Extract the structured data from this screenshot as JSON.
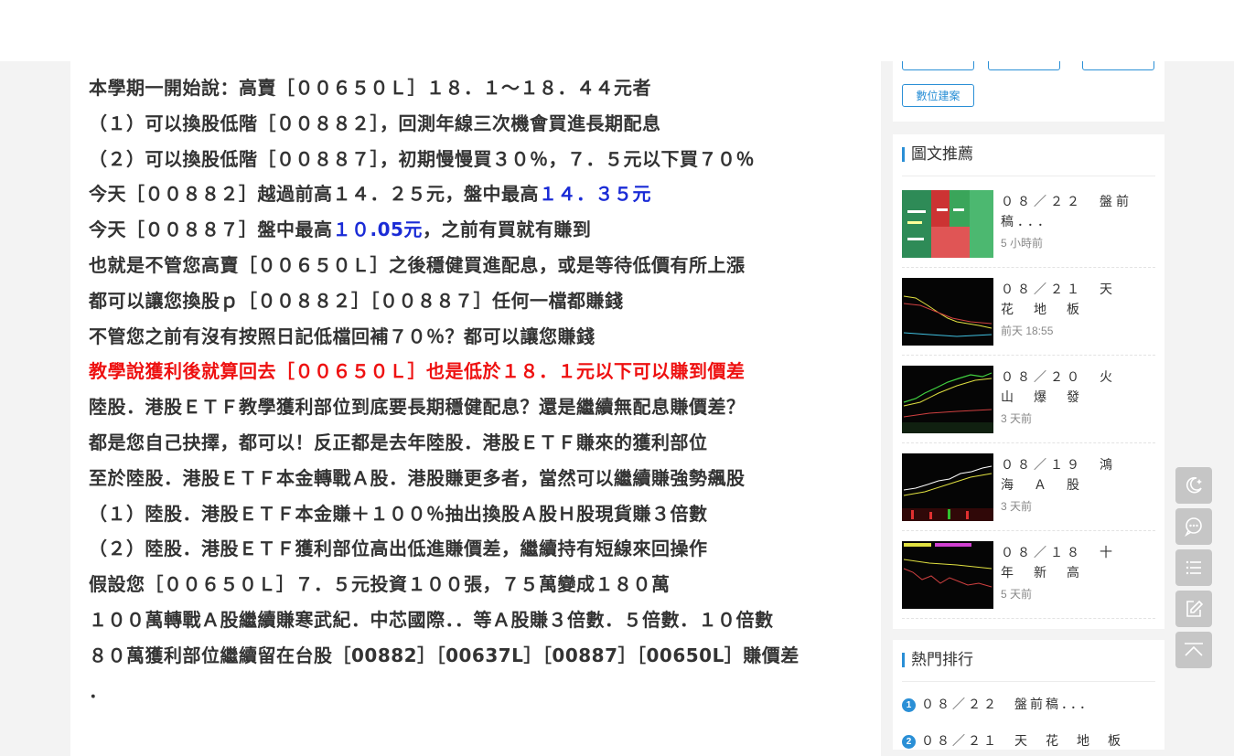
{
  "article": {
    "lines": [
      {
        "text": "本學期一開始說：高賣［００６５０Ｌ］１８．１～１８．４４元者"
      },
      {
        "text": "（１）可以換股低階［００８８２］，回測年線三次機會買進長期配息"
      },
      {
        "text": "（２）可以換股低階［００８８７］，初期慢慢買３０％，７．５元以下買７０％"
      },
      {
        "text": "今天［００８８２］越過前高１４．２５元，盤中最高",
        "highlight": "１４．３５元"
      },
      {
        "text": "今天［００８８７］盤中最高",
        "highlight": "１０.05元",
        "suffix": "，之前有買就有賺到"
      },
      {
        "text": "也就是不管您高賣［００６５０Ｌ］之後穩健買進配息，或是等待低價有所上漲"
      },
      {
        "text": "都可以讓您換股ｐ［００８８２］［００８８７］任何一檔都賺錢"
      },
      {
        "text": "不管您之前有沒有按照日記低檔回補７０％？都可以讓您賺錢"
      },
      {
        "text": "教學說獲利後就算回去［００６５０Ｌ］也是低於１８．１元以下可以賺到價差",
        "red": true
      },
      {
        "text": "陸股．港股ＥＴＦ教學獲利部位到底要長期穩健配息？還是繼續無配息賺價差？"
      },
      {
        "text": "都是您自己抉擇，都可以！反正都是去年陸股．港股ＥＴＦ賺來的獲利部位"
      },
      {
        "text": "至於陸股．港股ＥＴＦ本金轉戰Ａ股．港股賺更多者，當然可以繼續賺強勢飆股"
      },
      {
        "text": "（１）陸股．港股ＥＴＦ本金賺＋１００％抽出換股Ａ股Ｈ股現貨賺３倍數"
      },
      {
        "text": "（２）陸股．港股ＥＴＦ獲利部位高出低進賺價差，繼續持有短線來回操作"
      },
      {
        "text": "假設您［００６５０Ｌ］７．５元投資１００張，７５萬變成１８０萬"
      },
      {
        "text": "１００萬轉戰Ａ股繼續賺寒武紀．中芯國際．．等Ａ股賺３倍數．５倍數．１０倍數"
      },
      {
        "text": "８０萬獲利部位繼續留在台股［00882］［00637L］［00887］［00650L］賺價差"
      },
      {
        "text": "．"
      }
    ]
  },
  "sidebar": {
    "tags": [
      "數位建案"
    ],
    "recommended": {
      "title": "圖文推薦",
      "items": [
        {
          "title": "０８／２２　盤前稿．．．",
          "time": "5 小時前"
        },
        {
          "title": "０８／２１　天　花　地　板",
          "time": "前天 18:55"
        },
        {
          "title": "０８／２０　火　山　爆　發",
          "time": "3 天前"
        },
        {
          "title": "０８／１９　鴻　海　Ａ　股",
          "time": "3 天前"
        },
        {
          "title": "０８／１８　十　年　新　高",
          "time": "5 天前"
        }
      ]
    },
    "hot": {
      "title": "熱門排行",
      "items": [
        {
          "rank": "1",
          "title": "０８／２２　盤前稿．．．"
        },
        {
          "rank": "2",
          "title": "０８／２１　天　花　地　板"
        }
      ]
    }
  },
  "floating": {
    "buttons": [
      "moon-icon",
      "chat-icon",
      "list-icon",
      "edit-icon",
      "back-to-top-icon"
    ]
  }
}
